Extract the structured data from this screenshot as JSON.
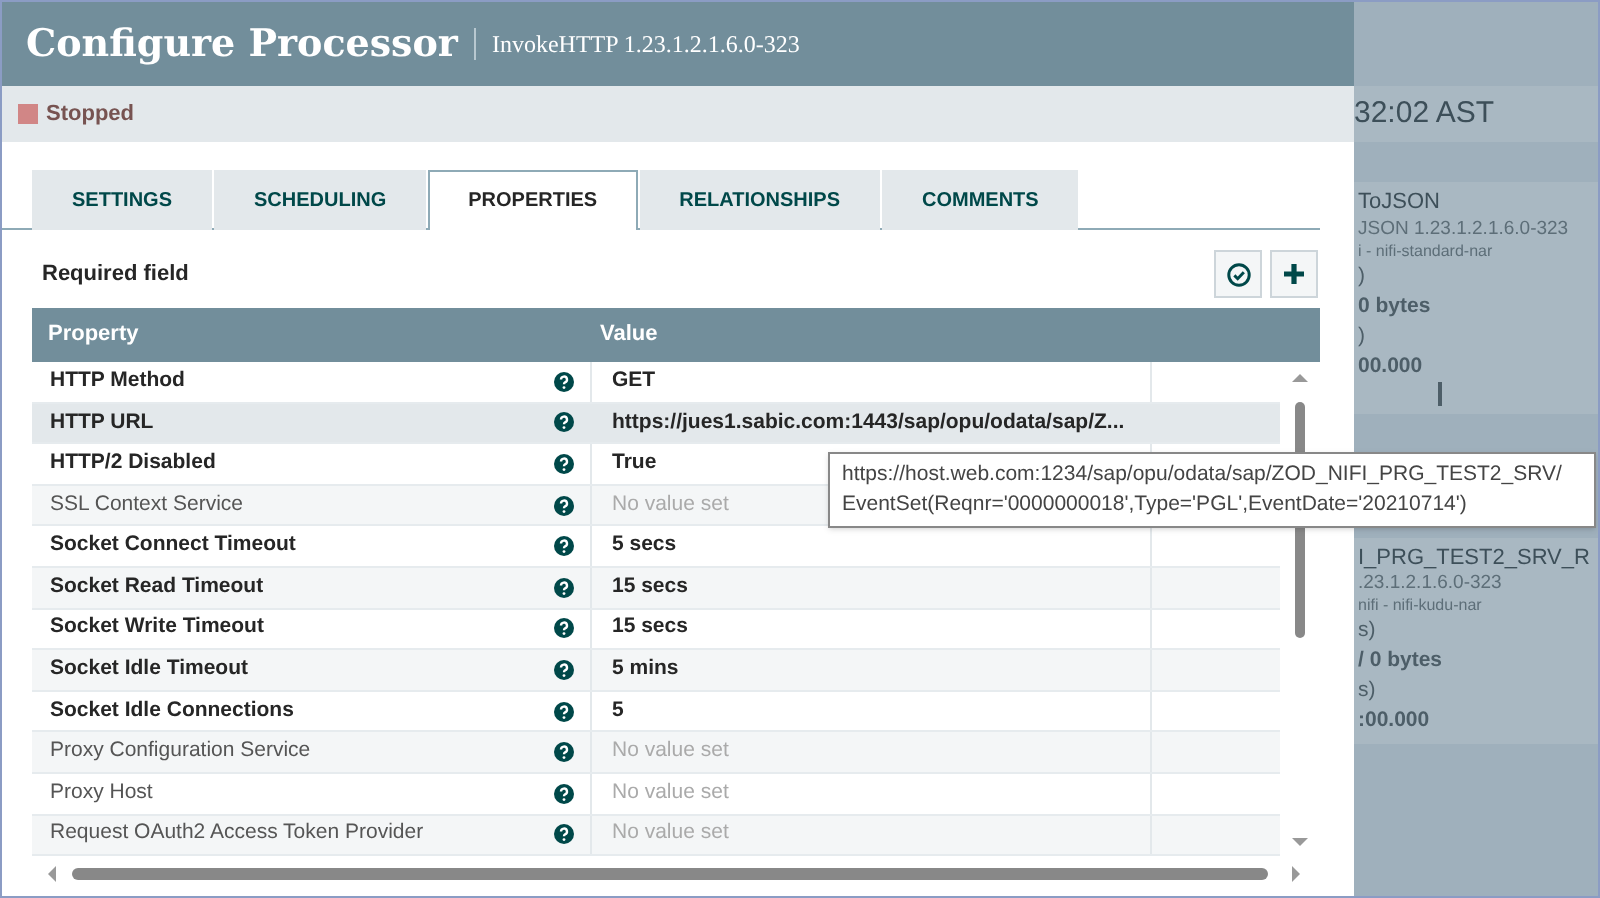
{
  "dialog": {
    "title": "Configure Processor",
    "subtitle": "InvokeHTTP 1.23.1.2.1.6.0-323",
    "status": "Stopped"
  },
  "tabs": [
    {
      "label": "SETTINGS",
      "selected": false
    },
    {
      "label": "SCHEDULING",
      "selected": false
    },
    {
      "label": "PROPERTIES",
      "selected": true
    },
    {
      "label": "RELATIONSHIPS",
      "selected": false
    },
    {
      "label": "COMMENTS",
      "selected": false
    }
  ],
  "required_note": "Required field",
  "table": {
    "columns": [
      "Property",
      "Value"
    ],
    "rows": [
      {
        "property": "HTTP Method",
        "value": "GET",
        "required": true,
        "has_value": true,
        "selected": false
      },
      {
        "property": "HTTP URL",
        "value": "https://jues1.sabic.com:1443/sap/opu/odata/sap/Z...",
        "required": true,
        "has_value": true,
        "selected": true
      },
      {
        "property": "HTTP/2 Disabled",
        "value": "True",
        "required": true,
        "has_value": true,
        "selected": false
      },
      {
        "property": "SSL Context Service",
        "value": "No value set",
        "required": false,
        "has_value": false,
        "selected": false
      },
      {
        "property": "Socket Connect Timeout",
        "value": "5 secs",
        "required": true,
        "has_value": true,
        "selected": false
      },
      {
        "property": "Socket Read Timeout",
        "value": "15 secs",
        "required": true,
        "has_value": true,
        "selected": false
      },
      {
        "property": "Socket Write Timeout",
        "value": "15 secs",
        "required": true,
        "has_value": true,
        "selected": false
      },
      {
        "property": "Socket Idle Timeout",
        "value": "5 mins",
        "required": true,
        "has_value": true,
        "selected": false
      },
      {
        "property": "Socket Idle Connections",
        "value": "5",
        "required": true,
        "has_value": true,
        "selected": false
      },
      {
        "property": "Proxy Configuration Service",
        "value": "No value set",
        "required": false,
        "has_value": false,
        "selected": false
      },
      {
        "property": "Proxy Host",
        "value": "No value set",
        "required": false,
        "has_value": false,
        "selected": false
      },
      {
        "property": "Request OAuth2 Access Token Provider",
        "value": "No value set",
        "required": false,
        "has_value": false,
        "selected": false
      }
    ]
  },
  "tooltip": {
    "lines": [
      "https://host.web.com:1234/sap/opu/odata/sap/ZOD_NIFI_PRG_TEST2_SRV/",
      "EventSet(Reqnr='0000000018',Type='PGL',EventDate='20210714')"
    ]
  },
  "canvas": {
    "time": "32:02 AST",
    "processor_1": {
      "name": "ToJSON",
      "version": "JSON 1.23.1.2.1.6.0-323",
      "bundle": "i - nifi-standard-nar",
      "stats": [
        ")",
        "0 bytes",
        ")",
        "00.000"
      ]
    },
    "processor_2": {
      "name": "I_PRG_TEST2_SRV_R",
      "version": ".23.1.2.1.6.0-323",
      "bundle": "nifi - nifi-kudu-nar",
      "stats": [
        "s)",
        "/ 0 bytes",
        "s)",
        ":00.000"
      ]
    }
  }
}
